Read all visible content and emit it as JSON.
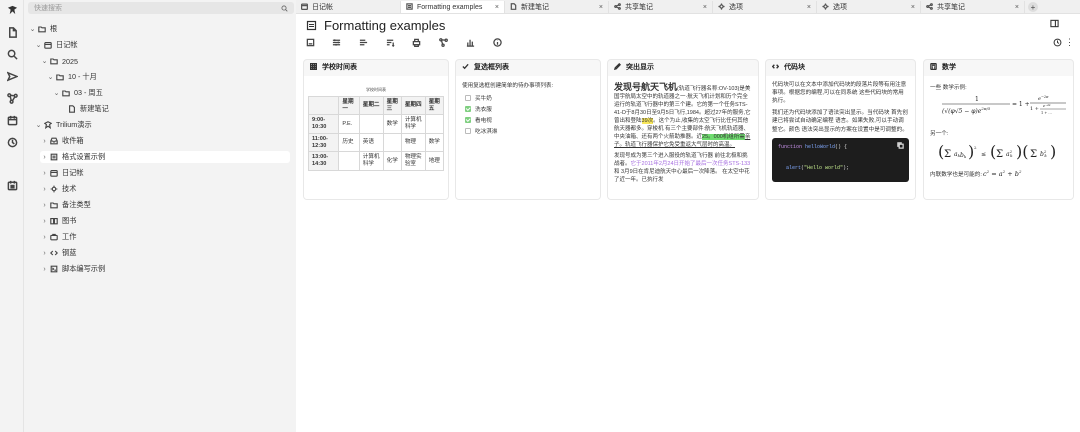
{
  "search": {
    "placeholder": "快速搜索"
  },
  "tree": {
    "root": "根",
    "diary": "日记帐",
    "year": "2025",
    "month": "10 - 十月",
    "day": "03 - 周五",
    "new_note": "新建笔记",
    "trilium_demo": "Trilium演示",
    "inbox": "收件箱",
    "formatting": "格式设置示例",
    "diary2": "日记帐",
    "tech": "技术",
    "note_types": "备注类型",
    "books": "图书",
    "work": "工作",
    "steel_blue": "钢蓝",
    "scripts": "脚本编写示例"
  },
  "tabs": [
    {
      "label": "日记帐"
    },
    {
      "label": "Formatting examples"
    },
    {
      "label": "新建笔记"
    },
    {
      "label": "共享笔记"
    },
    {
      "label": "选项"
    },
    {
      "label": "选项"
    },
    {
      "label": "共享笔记"
    }
  ],
  "note": {
    "title": "Formatting examples"
  },
  "cards": {
    "table": {
      "title": "学校时间表",
      "caption": "学校时间表",
      "headers": [
        "",
        "星期一",
        "星期二",
        "星期三",
        "星期四",
        "星期五"
      ],
      "rows": [
        [
          "9:00-10:30",
          "P.E.",
          "",
          "数学",
          "计算机科学",
          ""
        ],
        [
          "11:00-12:30",
          "历史",
          "英语",
          "",
          "物理",
          "数学"
        ],
        [
          "13:00-14:30",
          "",
          "计算机科学",
          "化学",
          "物理实验室",
          "地理"
        ]
      ]
    },
    "checklist": {
      "title": "复选框列表",
      "note": "使用复选框创建简单的待办事项列表:",
      "items": [
        {
          "label": "买牛奶",
          "checked": false
        },
        {
          "label": "洗衣服",
          "checked": true
        },
        {
          "label": "看电视",
          "checked": true
        },
        {
          "label": "吃冰淇淋",
          "checked": false
        }
      ]
    },
    "highlight": {
      "title": "突出显示",
      "big": "发现号航天飞机",
      "t1": "(轨道飞行器名称:OV-103)是美国宇航局太空中的轨道器之一·航天飞机计划和历个完全运行的轨道飞行器中的第三个建。它的第一个任务STS-41-D于8月30日至9月5日飞行,1984。超过27年的服务,它曾出和登陆",
      "y1": "39次",
      "t2": "。这个为止,收集的太空飞行比任何其他航天器都多。穿梭机 有三个主要部件:航天飞机轨道器、中央油箱、还有两个火箭助推器。近",
      "g1": "25。000机组所需",
      "t3": "亲子。轨道飞行器保护它免受重返大气层时的高温。",
      "t4": "发现号成为第三个进入服役的轨道飞行器 前往北极和挑战者。",
      "p1": "它于2011年2月24日开始了最后一次任务STS-133",
      "t5": "和 3月9日在肯尼迪航天中心最后一次降落。 在太空中花了近一年。已执行发"
    },
    "code": {
      "title": "代码块",
      "p1": "代码块可以在文本中添加代码块的段落片段等有用注意事项。根据您的编程,可以在同系统 这些代码块的常用执行。",
      "p2": "我们还为代码块添加了语法突出显示。当代码块 首先创建已将尝试自动确定编程 语言。如果失败,可以手动调整它。颜色 语法突出显示的方案在设置中是可调整的。",
      "code_line1_kw": "function",
      "code_line1_fn": "helloWorld",
      "code_line1_rest": "() {",
      "code_line2_fn": "alert",
      "code_line2_str": "\"Hello world\"",
      "code_line2_rest": ");"
    },
    "math": {
      "title": "数学",
      "t1": "一些 数学示例:",
      "t2": "另一个:",
      "t3": "内联数学也是可能的:"
    }
  },
  "colors": {
    "accent_green": "#7fcf80",
    "highlight_yellow": "#f7e65a",
    "highlight_green": "#6fdc6f",
    "code_bg": "#1d1d1d"
  }
}
